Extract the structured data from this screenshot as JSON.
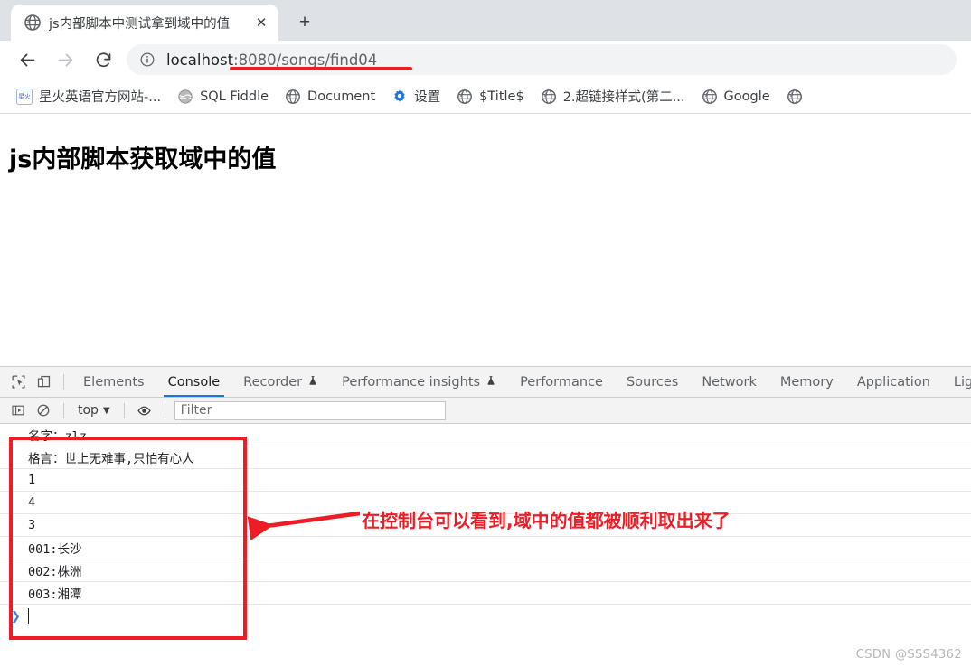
{
  "browser": {
    "tab": {
      "title": "js内部脚本中测试拿到域中的值",
      "favicon_name": "globe-icon",
      "close_label": "✕"
    },
    "new_tab_label": "+",
    "nav": {
      "back_label": "←",
      "forward_label": "→",
      "reload_label": "⟳"
    },
    "omnibox": {
      "info_icon": "info-circle-icon",
      "host": "localhost",
      "path": ":8080/songs/find04",
      "full_url": "localhost:8080/songs/find04"
    },
    "bookmarks": [
      {
        "label": "星火英语官方网站-...",
        "icon": "xinghuo-favicon"
      },
      {
        "label": "SQL Fiddle",
        "icon": "sql-fiddle-favicon"
      },
      {
        "label": "Document",
        "icon": "globe-icon"
      },
      {
        "label": "设置",
        "icon": "gear-icon"
      },
      {
        "label": "$Title$",
        "icon": "globe-icon"
      },
      {
        "label": "2.超链接样式(第二...",
        "icon": "globe-icon"
      },
      {
        "label": "Google",
        "icon": "globe-icon"
      },
      {
        "label": "",
        "icon": "globe-icon"
      }
    ]
  },
  "page": {
    "heading": "js内部脚本获取域中的值"
  },
  "devtools": {
    "toolbar_icons": {
      "inspect": "inspect-element-icon",
      "device": "device-toolbar-icon"
    },
    "tabs": [
      {
        "label": "Elements",
        "active": false,
        "flask": false
      },
      {
        "label": "Console",
        "active": true,
        "flask": false
      },
      {
        "label": "Recorder",
        "active": false,
        "flask": true
      },
      {
        "label": "Performance insights",
        "active": false,
        "flask": true
      },
      {
        "label": "Performance",
        "active": false,
        "flask": false
      },
      {
        "label": "Sources",
        "active": false,
        "flask": false
      },
      {
        "label": "Network",
        "active": false,
        "flask": false
      },
      {
        "label": "Memory",
        "active": false,
        "flask": false
      },
      {
        "label": "Application",
        "active": false,
        "flask": false
      },
      {
        "label": "Lig",
        "active": false,
        "flask": false
      }
    ],
    "console_toolbar": {
      "sidebar_icon": "console-sidebar-icon",
      "clear_icon": "clear-console-icon",
      "context": "top",
      "context_caret": "▼",
      "eye_icon": "live-expression-icon",
      "filter_placeholder": "Filter"
    },
    "console_lines": [
      "名字：zlz",
      "格言：世上无难事,只怕有心人",
      "1",
      "4",
      "3",
      "001:长沙",
      "002:株洲",
      "003:湘潭"
    ],
    "prompt_symbol": "❯"
  },
  "annotations": {
    "callout_text": "在控制台可以看到,域中的值都被顺利取出来了",
    "accent_color": "#ee1c25"
  },
  "watermark": "CSDN @SSS4362"
}
